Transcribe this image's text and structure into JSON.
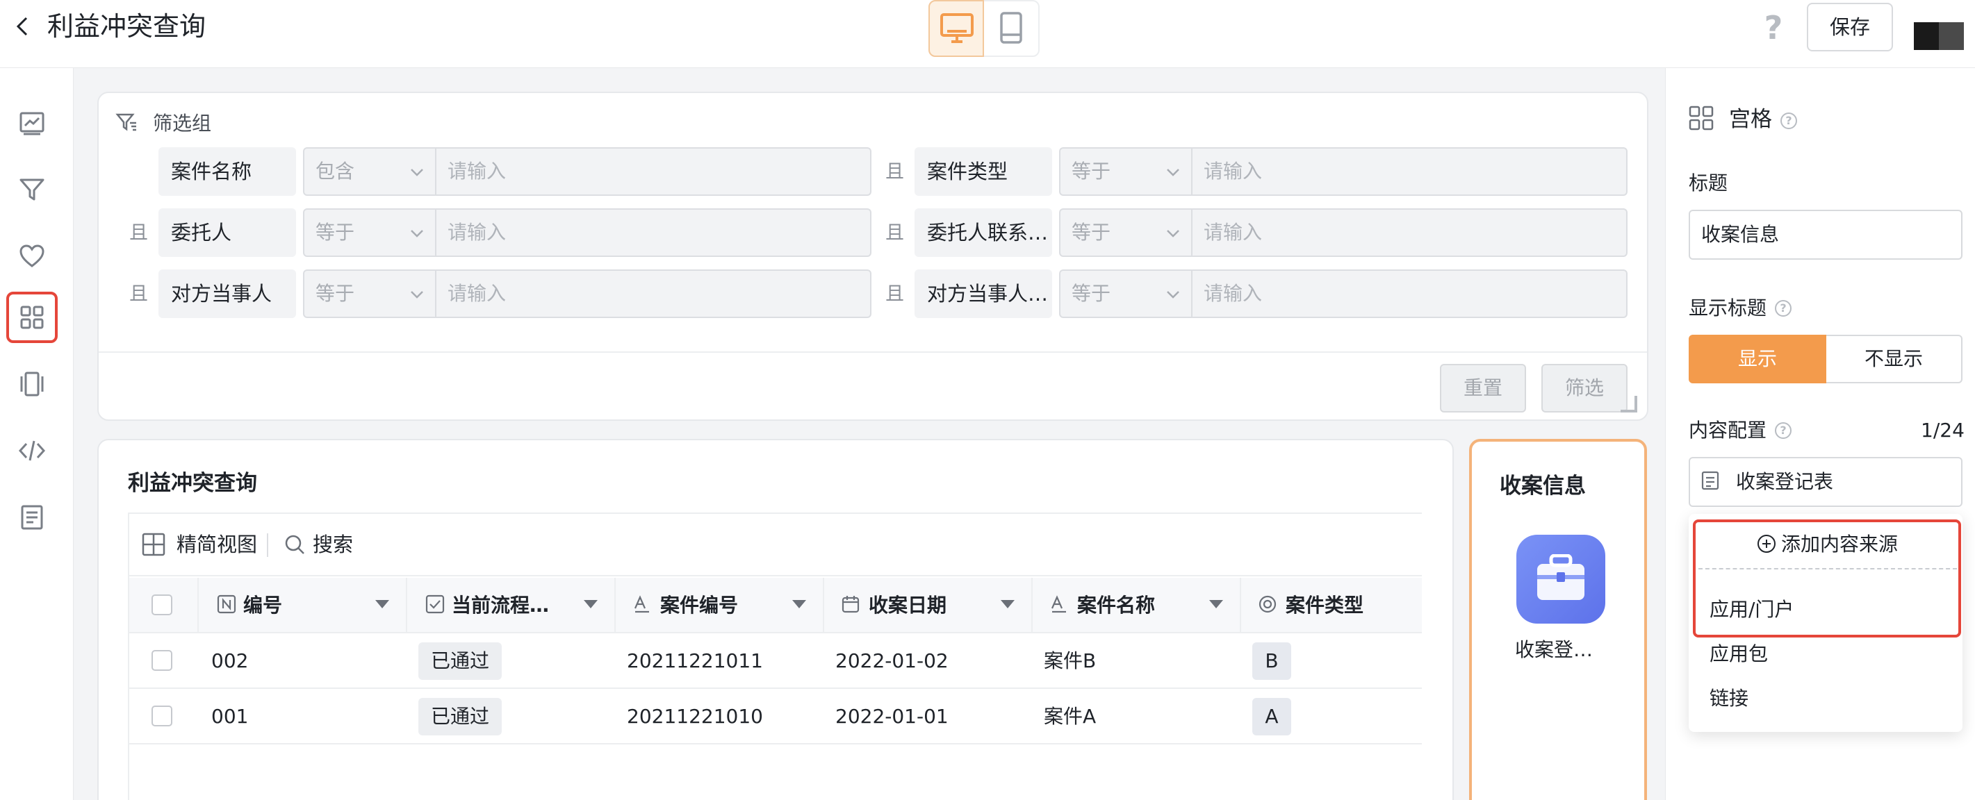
{
  "header": {
    "title": "利益冲突查询",
    "save_label": "保存",
    "help_glyph": "?"
  },
  "filter": {
    "group_label": "筛选组",
    "and_label": "且",
    "fields": [
      {
        "name": "案件名称",
        "op": "包含",
        "placeholder": "请输入"
      },
      {
        "name": "案件类型",
        "op": "等于",
        "placeholder": "请输入"
      },
      {
        "name": "委托人",
        "op": "等于",
        "placeholder": "请输入"
      },
      {
        "name": "委托人联系…",
        "op": "等于",
        "placeholder": "请输入"
      },
      {
        "name": "对方当事人",
        "op": "等于",
        "placeholder": "请输入"
      },
      {
        "name": "对方当事人…",
        "op": "等于",
        "placeholder": "请输入"
      }
    ],
    "reset_label": "重置",
    "filter_label": "筛选"
  },
  "table": {
    "title": "利益冲突查询",
    "view_label": "精简视图",
    "search_label": "搜索",
    "columns": [
      "编号",
      "当前流程…",
      "案件编号",
      "收案日期",
      "案件名称",
      "案件类型"
    ],
    "rows": [
      {
        "id": "002",
        "status": "已通过",
        "case_no": "20211221011",
        "date": "2022-01-02",
        "name": "案件B",
        "type": "B"
      },
      {
        "id": "001",
        "status": "已通过",
        "case_no": "20211221010",
        "date": "2022-01-01",
        "name": "案件A",
        "type": "A"
      }
    ]
  },
  "grid": {
    "title": "收案信息",
    "item_label": "收案登…"
  },
  "config": {
    "title": "宫格",
    "title_field_label": "标题",
    "title_value": "收案信息",
    "show_title_label": "显示标题",
    "show_label": "显示",
    "hide_label": "不显示",
    "content_label": "内容配置",
    "content_count": "1/24",
    "source_name": "收案登记表",
    "add_source_label": "添加内容来源",
    "menu": [
      "应用/门户",
      "应用包",
      "链接"
    ]
  },
  "colors": {
    "accent": "#f39b4c",
    "highlight_red": "#e5463a",
    "icon_blue": "#6b80f0"
  }
}
